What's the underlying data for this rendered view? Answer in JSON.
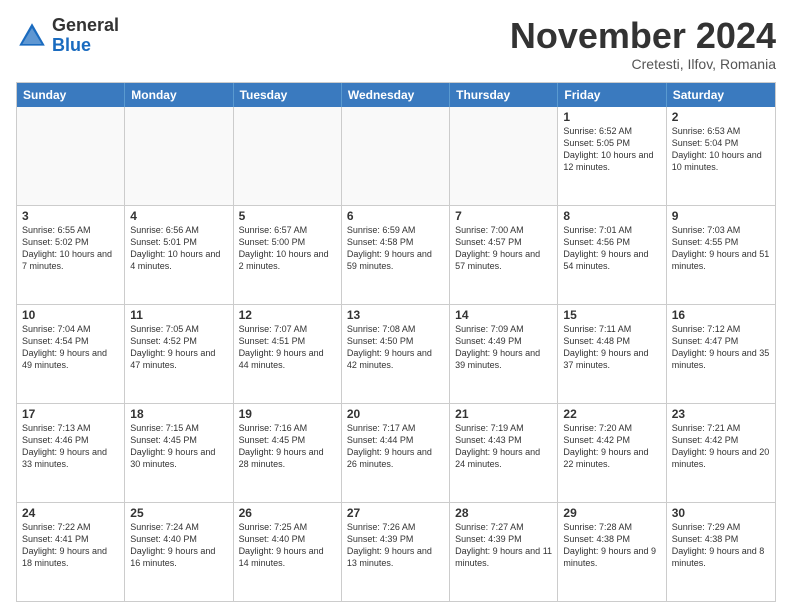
{
  "logo": {
    "general": "General",
    "blue": "Blue"
  },
  "header": {
    "month": "November 2024",
    "location": "Cretesti, Ilfov, Romania"
  },
  "weekdays": [
    "Sunday",
    "Monday",
    "Tuesday",
    "Wednesday",
    "Thursday",
    "Friday",
    "Saturday"
  ],
  "rows": [
    [
      {
        "day": "",
        "info": ""
      },
      {
        "day": "",
        "info": ""
      },
      {
        "day": "",
        "info": ""
      },
      {
        "day": "",
        "info": ""
      },
      {
        "day": "",
        "info": ""
      },
      {
        "day": "1",
        "info": "Sunrise: 6:52 AM\nSunset: 5:05 PM\nDaylight: 10 hours and 12 minutes."
      },
      {
        "day": "2",
        "info": "Sunrise: 6:53 AM\nSunset: 5:04 PM\nDaylight: 10 hours and 10 minutes."
      }
    ],
    [
      {
        "day": "3",
        "info": "Sunrise: 6:55 AM\nSunset: 5:02 PM\nDaylight: 10 hours and 7 minutes."
      },
      {
        "day": "4",
        "info": "Sunrise: 6:56 AM\nSunset: 5:01 PM\nDaylight: 10 hours and 4 minutes."
      },
      {
        "day": "5",
        "info": "Sunrise: 6:57 AM\nSunset: 5:00 PM\nDaylight: 10 hours and 2 minutes."
      },
      {
        "day": "6",
        "info": "Sunrise: 6:59 AM\nSunset: 4:58 PM\nDaylight: 9 hours and 59 minutes."
      },
      {
        "day": "7",
        "info": "Sunrise: 7:00 AM\nSunset: 4:57 PM\nDaylight: 9 hours and 57 minutes."
      },
      {
        "day": "8",
        "info": "Sunrise: 7:01 AM\nSunset: 4:56 PM\nDaylight: 9 hours and 54 minutes."
      },
      {
        "day": "9",
        "info": "Sunrise: 7:03 AM\nSunset: 4:55 PM\nDaylight: 9 hours and 51 minutes."
      }
    ],
    [
      {
        "day": "10",
        "info": "Sunrise: 7:04 AM\nSunset: 4:54 PM\nDaylight: 9 hours and 49 minutes."
      },
      {
        "day": "11",
        "info": "Sunrise: 7:05 AM\nSunset: 4:52 PM\nDaylight: 9 hours and 47 minutes."
      },
      {
        "day": "12",
        "info": "Sunrise: 7:07 AM\nSunset: 4:51 PM\nDaylight: 9 hours and 44 minutes."
      },
      {
        "day": "13",
        "info": "Sunrise: 7:08 AM\nSunset: 4:50 PM\nDaylight: 9 hours and 42 minutes."
      },
      {
        "day": "14",
        "info": "Sunrise: 7:09 AM\nSunset: 4:49 PM\nDaylight: 9 hours and 39 minutes."
      },
      {
        "day": "15",
        "info": "Sunrise: 7:11 AM\nSunset: 4:48 PM\nDaylight: 9 hours and 37 minutes."
      },
      {
        "day": "16",
        "info": "Sunrise: 7:12 AM\nSunset: 4:47 PM\nDaylight: 9 hours and 35 minutes."
      }
    ],
    [
      {
        "day": "17",
        "info": "Sunrise: 7:13 AM\nSunset: 4:46 PM\nDaylight: 9 hours and 33 minutes."
      },
      {
        "day": "18",
        "info": "Sunrise: 7:15 AM\nSunset: 4:45 PM\nDaylight: 9 hours and 30 minutes."
      },
      {
        "day": "19",
        "info": "Sunrise: 7:16 AM\nSunset: 4:45 PM\nDaylight: 9 hours and 28 minutes."
      },
      {
        "day": "20",
        "info": "Sunrise: 7:17 AM\nSunset: 4:44 PM\nDaylight: 9 hours and 26 minutes."
      },
      {
        "day": "21",
        "info": "Sunrise: 7:19 AM\nSunset: 4:43 PM\nDaylight: 9 hours and 24 minutes."
      },
      {
        "day": "22",
        "info": "Sunrise: 7:20 AM\nSunset: 4:42 PM\nDaylight: 9 hours and 22 minutes."
      },
      {
        "day": "23",
        "info": "Sunrise: 7:21 AM\nSunset: 4:42 PM\nDaylight: 9 hours and 20 minutes."
      }
    ],
    [
      {
        "day": "24",
        "info": "Sunrise: 7:22 AM\nSunset: 4:41 PM\nDaylight: 9 hours and 18 minutes."
      },
      {
        "day": "25",
        "info": "Sunrise: 7:24 AM\nSunset: 4:40 PM\nDaylight: 9 hours and 16 minutes."
      },
      {
        "day": "26",
        "info": "Sunrise: 7:25 AM\nSunset: 4:40 PM\nDaylight: 9 hours and 14 minutes."
      },
      {
        "day": "27",
        "info": "Sunrise: 7:26 AM\nSunset: 4:39 PM\nDaylight: 9 hours and 13 minutes."
      },
      {
        "day": "28",
        "info": "Sunrise: 7:27 AM\nSunset: 4:39 PM\nDaylight: 9 hours and 11 minutes."
      },
      {
        "day": "29",
        "info": "Sunrise: 7:28 AM\nSunset: 4:38 PM\nDaylight: 9 hours and 9 minutes."
      },
      {
        "day": "30",
        "info": "Sunrise: 7:29 AM\nSunset: 4:38 PM\nDaylight: 9 hours and 8 minutes."
      }
    ]
  ]
}
